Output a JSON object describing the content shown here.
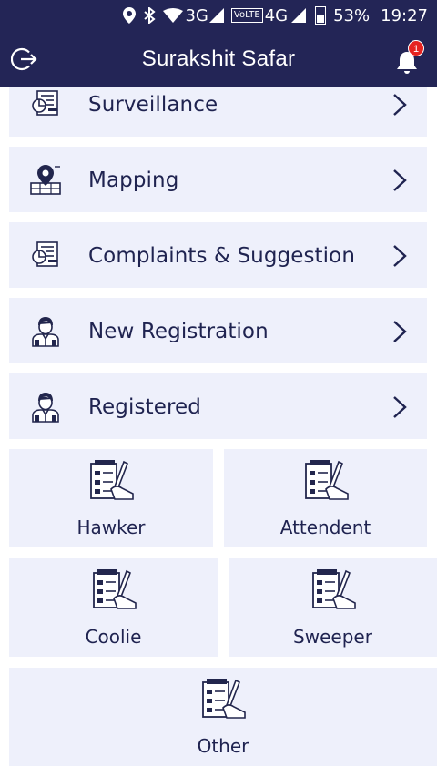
{
  "status_bar": {
    "network_3g": "3G",
    "volte": "VoLTE",
    "network_4g": "4G",
    "battery": "53%",
    "time": "19:27"
  },
  "app_bar": {
    "title": "Surakshit Safar",
    "notification_count": "1"
  },
  "menu": [
    {
      "label": "Surveillance",
      "icon": "clipboard-chart-icon"
    },
    {
      "label": "Mapping",
      "icon": "map-pin-icon"
    },
    {
      "label": "Complaints & Suggestion",
      "icon": "clipboard-chart-icon"
    },
    {
      "label": "New Registration",
      "icon": "person-icon"
    },
    {
      "label": "Registered",
      "icon": "person-icon"
    }
  ],
  "tiles": [
    {
      "label": "Hawker",
      "icon": "checklist-icon"
    },
    {
      "label": "Attendent",
      "icon": "checklist-icon"
    },
    {
      "label": "Coolie",
      "icon": "checklist-icon"
    },
    {
      "label": "Sweeper",
      "icon": "checklist-icon"
    },
    {
      "label": "Other",
      "icon": "checklist-icon"
    }
  ],
  "colors": {
    "primary": "#232556",
    "card_bg": "#eef0fb",
    "text": "#1f2350",
    "badge": "#e52320"
  }
}
